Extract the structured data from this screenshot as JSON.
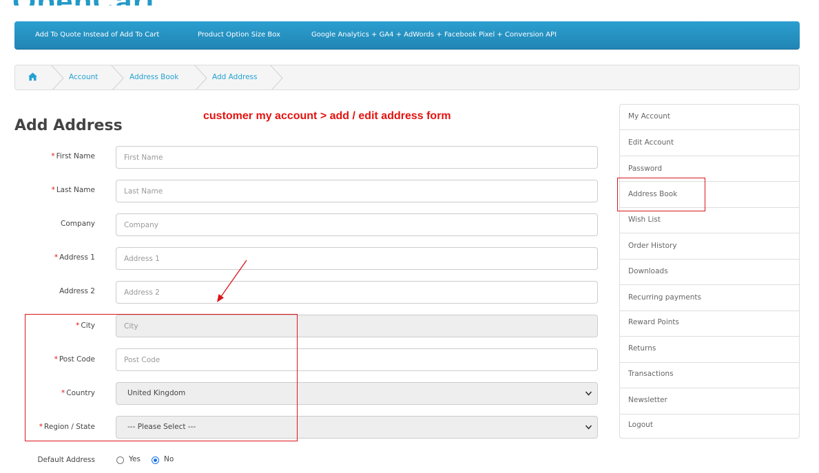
{
  "logo": {
    "text": "OpenCart"
  },
  "top_menu": {
    "items": [
      "Add To Quote Instead of Add To Cart",
      "Product Option Size Box",
      "Google Analytics + GA4 + AdWords + Facebook Pixel + Conversion API"
    ]
  },
  "breadcrumb": {
    "home_icon": "home-icon",
    "items": [
      "Account",
      "Address Book",
      "Add Address"
    ]
  },
  "page": {
    "title": "Add Address",
    "annotation": "customer my account > add / edit address form"
  },
  "form": {
    "required_mark": "*",
    "fields": [
      {
        "label": "First Name",
        "placeholder": "First Name",
        "required": true
      },
      {
        "label": "Last Name",
        "placeholder": "Last Name",
        "required": true
      },
      {
        "label": "Company",
        "placeholder": "Company",
        "required": false
      },
      {
        "label": "Address 1",
        "placeholder": "Address 1",
        "required": true
      },
      {
        "label": "Address 2",
        "placeholder": "Address 2",
        "required": false
      },
      {
        "label": "City",
        "placeholder": "City",
        "required": true
      },
      {
        "label": "Post Code",
        "placeholder": "Post Code",
        "required": true
      }
    ],
    "country": {
      "label": "Country",
      "value": "United Kingdom",
      "required": true
    },
    "region": {
      "label": "Region / State",
      "value": "--- Please Select ---",
      "required": true
    },
    "default_address": {
      "label": "Default Address",
      "yes": "Yes",
      "no": "No",
      "selected": "No"
    }
  },
  "sidebar": {
    "items": [
      "My Account",
      "Edit Account",
      "Password",
      "Address Book",
      "Wish List",
      "Order History",
      "Downloads",
      "Recurring payments",
      "Reward Points",
      "Returns",
      "Transactions",
      "Newsletter",
      "Logout"
    ]
  },
  "colors": {
    "brand_blue": "#229ac8",
    "annotation_red": "#e3130f",
    "link_blue": "#23a1d1"
  }
}
